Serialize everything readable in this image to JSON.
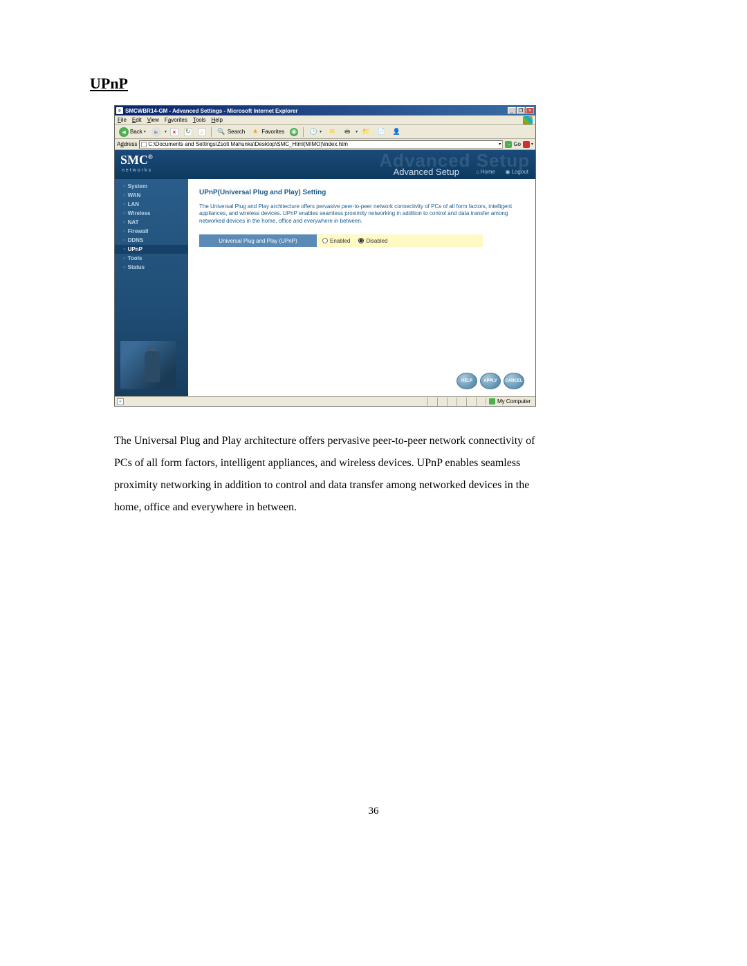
{
  "doc": {
    "heading": "UPnP",
    "body": "The Universal Plug and Play architecture offers pervasive peer-to-peer network connectivity of PCs of all form factors, intelligent appliances, and wireless devices. UPnP enables seamless proximity networking in addition to control and data transfer among networked devices in the home, office and everywhere in between.",
    "page_number": "36"
  },
  "browser": {
    "title": "SMCWBR14-GM - Advanced Settings - Microsoft Internet Explorer",
    "menu": {
      "file": "File",
      "edit": "Edit",
      "view": "View",
      "favorites": "Favorites",
      "tools": "Tools",
      "help": "Help"
    },
    "toolbar": {
      "back": "Back",
      "search": "Search",
      "favorites": "Favorites"
    },
    "addr_label": "Address",
    "address": "C:\\Documents and Settings\\Zsolt Mahunka\\Desktop\\SMC_Html(MIMO)\\index.htm",
    "go": "Go",
    "status_zone": "My Computer"
  },
  "router": {
    "brand": "SMC",
    "brand_sub": "Networks",
    "adv_bg": "Advanced Setup",
    "adv_title": "Advanced Setup",
    "home": "Home",
    "logout": "Logout",
    "nav": {
      "system": "System",
      "wan": "WAN",
      "lan": "LAN",
      "wireless": "Wireless",
      "nat": "NAT",
      "firewall": "Firewall",
      "ddns": "DDNS",
      "upnp": "UPnP",
      "tools": "Tools",
      "status": "Status"
    },
    "panel": {
      "title": "UPnP(Universal Plug and Play) Setting",
      "desc": "The Universal Plug and Play architecture offers pervasive peer-to-peer network connectivity of PCs of all form factors, intelligent appliances, and wireless devices. UPnP enables seamless proximity networking in addition to control and data transfer among networked devices in the home, office and everywhere in between.",
      "row_label": "Universal Plug and Play (UPnP)",
      "opt_enabled": "Enabled",
      "opt_disabled": "Disabled",
      "btn_help": "HELP",
      "btn_apply": "APPLY",
      "btn_cancel": "CANCEL"
    }
  }
}
